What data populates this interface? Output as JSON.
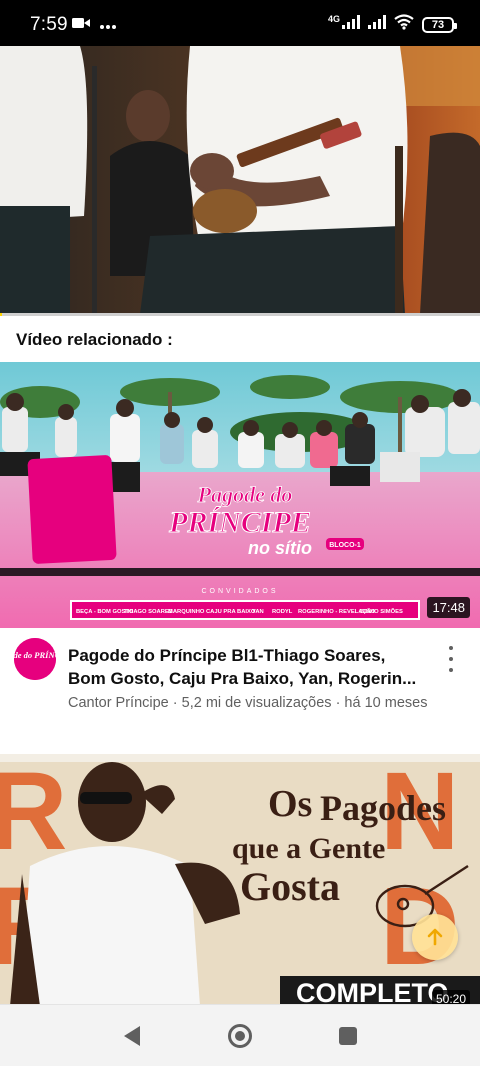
{
  "status_bar": {
    "time": "7:59",
    "network": "4G",
    "battery": "73",
    "icons": [
      "video-camera-icon",
      "more-dots-icon",
      "signal-icon",
      "signal-icon",
      "wifi-icon",
      "battery-icon"
    ]
  },
  "player": {
    "progress_fraction": 0.004,
    "progress_color": "#ffd400"
  },
  "section": {
    "title": "Vídeo relacionado :"
  },
  "video1": {
    "title_line1": "Pagode do Príncipe Bl1-Thiago Soares,",
    "title_line2": "Bom Gosto, Caju Pra Baixo, Yan, Rogerin...",
    "meta": "Cantor Príncipe · 5,2 mi de visualizações · há 10 meses",
    "duration": "17:48",
    "thumb_text": {
      "logo_line1": "Pagode do",
      "logo_line2": "PRÍNCIPE",
      "logo_line3": "no sítio",
      "bloco": "BLOCO-1",
      "convidados": "CONVIDADOS",
      "guests": [
        "BEÇA - BOM GOSTO",
        "THIAGO SOARES",
        "MARQUINHO",
        "CAJU PRA BAIXO",
        "YAN",
        "RODYL",
        "ROGERINHO - REVELAÇÃO",
        "BINHO SIMÕES"
      ]
    },
    "avatar_text": "Pagode do PRÍNCIPE"
  },
  "video2": {
    "duration": "50:20",
    "thumb_text": {
      "line1": "Os",
      "line2": "Pagodes",
      "line3": "que a Gente",
      "line4": "Gosta",
      "badge": "COMPLETO"
    }
  },
  "colors": {
    "accent_pink": "#e6007e",
    "meta_gray": "#606060"
  }
}
